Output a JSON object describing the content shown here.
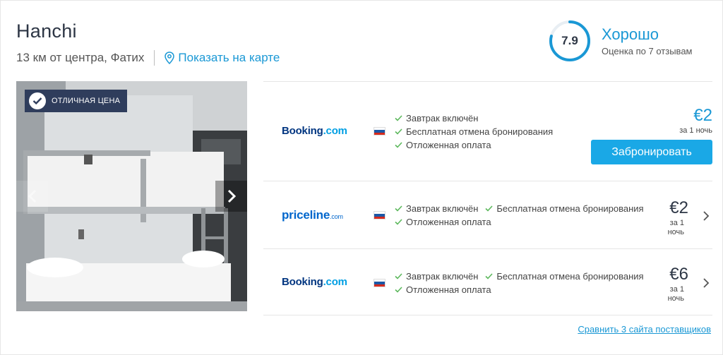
{
  "hotel": {
    "name": "Hanchi",
    "distance": "13 км от центра, Фатих",
    "map_link": "Показать на карте"
  },
  "rating": {
    "score": "7.9",
    "label": "Хорошо",
    "reviews": "Оценка по 7 отзывам",
    "fill_fraction": 0.79,
    "accent": "#1a98d5"
  },
  "photo": {
    "badge": "ОТЛИЧНАЯ ЦЕНА",
    "icons": [
      "check-icon",
      "chevron-left-icon",
      "chevron-right-icon"
    ]
  },
  "offers": [
    {
      "provider_logo": {
        "dark": "Booking",
        "light": ".com"
      },
      "features": [
        "Завтрак включён",
        "Бесплатная отмена бронирования",
        "Отложенная оплата"
      ],
      "price": "€2",
      "per_night": "за 1 ночь",
      "button": "Забронировать"
    },
    {
      "provider_logo": {
        "main": "priceline",
        "suffix": ".com"
      },
      "features": [
        "Завтрак включён",
        "Бесплатная отмена бронирования",
        "Отложенная оплата"
      ],
      "price": "€2",
      "per_night_1": "за 1",
      "per_night_2": "ночь"
    },
    {
      "provider_logo": {
        "dark": "Booking",
        "light": ".com"
      },
      "features": [
        "Завтрак включён",
        "Бесплатная отмена бронирования",
        "Отложенная оплата"
      ],
      "price": "€6",
      "per_night_1": "за 1",
      "per_night_2": "ночь"
    }
  ],
  "compare_link": "Сравнить 3 сайта поставщиков",
  "colors": {
    "accent": "#1a98d5",
    "button": "#1aa8e6",
    "badge": "#2f3d5c",
    "check": "#5cb85c"
  }
}
